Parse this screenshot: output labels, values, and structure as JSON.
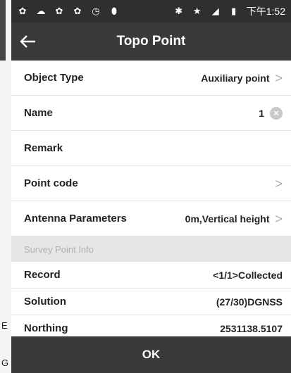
{
  "status_bar": {
    "time": "下午1:52"
  },
  "header": {
    "title": "Topo Point"
  },
  "rows": {
    "object_type": {
      "label": "Object Type",
      "value": "Auxiliary point"
    },
    "name": {
      "label": "Name",
      "value": "1"
    },
    "remark": {
      "label": "Remark"
    },
    "point_code": {
      "label": "Point code"
    },
    "antenna": {
      "label": "Antenna Parameters",
      "value": "0m,Vertical height"
    }
  },
  "section": {
    "title": "Survey Point Info"
  },
  "info": {
    "record": {
      "label": "Record",
      "value": "<1/1>Collected"
    },
    "solution": {
      "label": "Solution",
      "value": "(27/30)DGNSS"
    },
    "northing": {
      "label": "Northing",
      "value": "2531138.5107"
    }
  },
  "footer": {
    "ok_label": "OK"
  },
  "edge": {
    "digit": "E",
    "digit2": "G"
  }
}
